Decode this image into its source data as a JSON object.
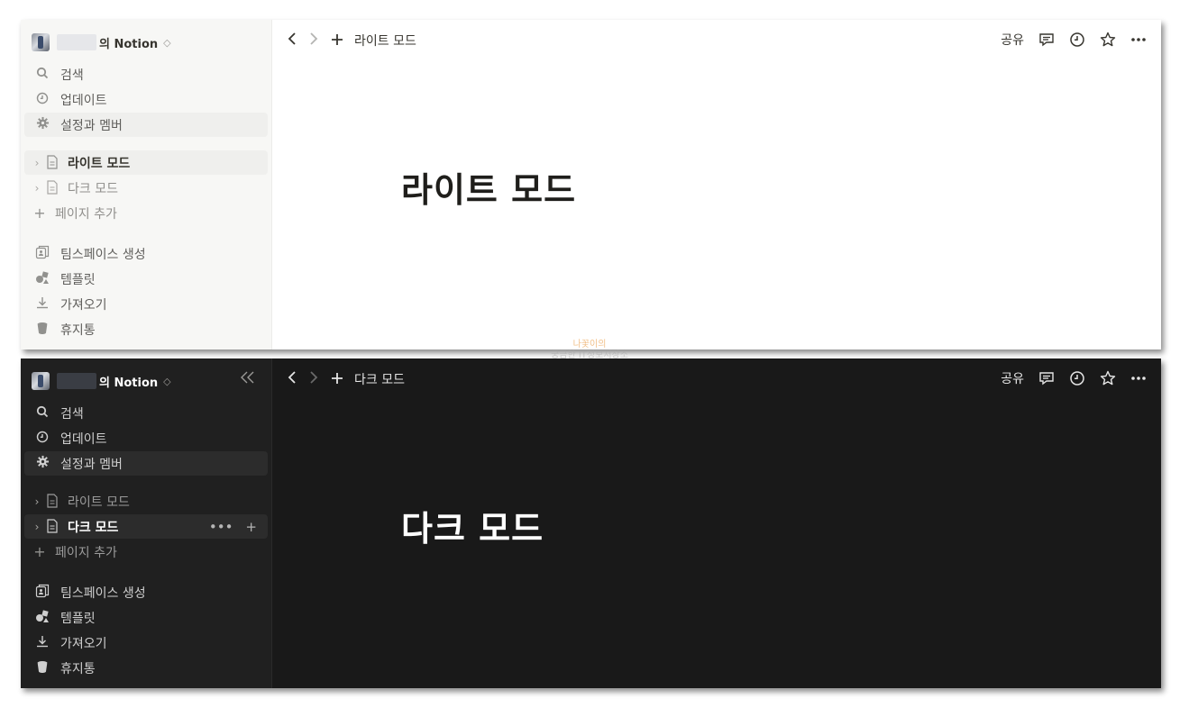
{
  "workspace": {
    "suffix": "의 Notion",
    "switch_icon": "chevron-updown-icon"
  },
  "sidebar": {
    "collapse_icon": "double-chevron-left-icon",
    "nav": [
      {
        "label": "검색",
        "icon": "search-icon"
      },
      {
        "label": "업데이트",
        "icon": "clock-icon"
      },
      {
        "label": "설정과 멤버",
        "icon": "gear-icon"
      }
    ],
    "pages": [
      {
        "label": "라이트 모드",
        "icon": "page-icon"
      },
      {
        "label": "다크 모드",
        "icon": "page-icon"
      }
    ],
    "add_page": "페이지 추가",
    "bottom": [
      {
        "label": "팀스페이스 생성",
        "icon": "teamspace-icon"
      },
      {
        "label": "템플릿",
        "icon": "templates-icon"
      },
      {
        "label": "가져오기",
        "icon": "download-icon"
      },
      {
        "label": "휴지통",
        "icon": "trash-icon"
      }
    ]
  },
  "topbar": {
    "share": "공유"
  },
  "light": {
    "breadcrumb": "라이트 모드",
    "title": "라이트 모드"
  },
  "dark": {
    "breadcrumb": "다크 모드",
    "title": "다크 모드"
  },
  "watermark": {
    "line1": "나꽃이의",
    "line2": "궁금한 IT정보저장소"
  },
  "colors": {
    "light_sidebar": "#f7f7f5",
    "dark_bg": "#191919",
    "dark_sidebar": "#202020"
  }
}
